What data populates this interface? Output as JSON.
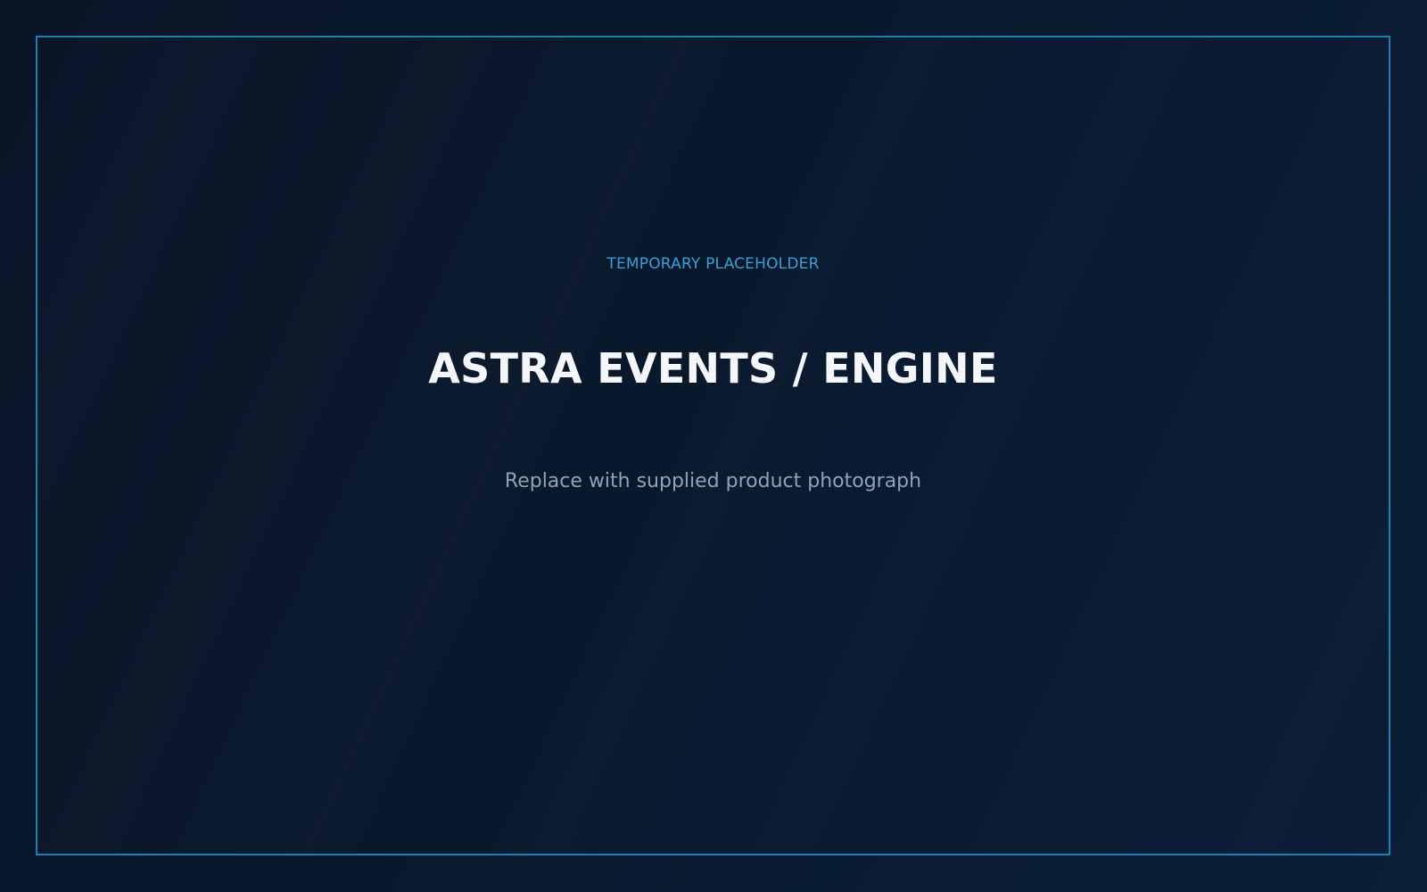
{
  "placeholder": {
    "eyebrow": "TEMPORARY PLACEHOLDER",
    "title": "ASTRA EVENTS / ENGINE",
    "subtitle": "Replace with supplied product photograph"
  },
  "colors": {
    "background": "#0a1628",
    "border": "#1f7fb0",
    "eyebrow": "#3a9fd8",
    "title": "#f4f6f9",
    "subtitle": "#8ea3b8"
  }
}
